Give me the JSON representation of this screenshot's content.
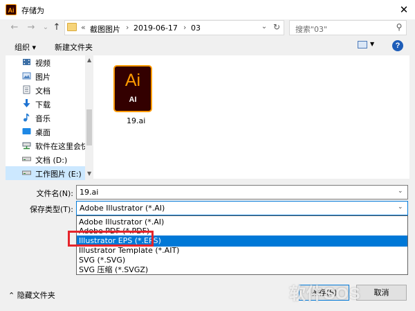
{
  "window": {
    "title": "存储为",
    "app_icon_text": "Ai",
    "close_glyph": "✕"
  },
  "nav": {
    "back": "←",
    "forward": "→",
    "recent": "⌄",
    "up": "↑"
  },
  "address": {
    "overflow": "«",
    "crumbs": [
      "截图图片",
      "2019-06-17",
      "03"
    ],
    "separator": "›",
    "dropdown": "⌄",
    "refresh": "↻"
  },
  "search": {
    "placeholder": "搜索\"03\"",
    "icon": "⚲"
  },
  "toolbar": {
    "organize": "组织 ▾",
    "new_folder": "新建文件夹",
    "help": "?"
  },
  "sidebar": {
    "items": [
      {
        "label": "视频",
        "icon": "video-icon",
        "color": "#3b6ea5"
      },
      {
        "label": "图片",
        "icon": "pictures-icon",
        "color": "#4f83c0"
      },
      {
        "label": "文档",
        "icon": "documents-icon",
        "color": "#6c7a89"
      },
      {
        "label": "下载",
        "icon": "download-icon",
        "color": "#1e73d2"
      },
      {
        "label": "音乐",
        "icon": "music-icon",
        "color": "#2a7fd4"
      },
      {
        "label": "桌面",
        "icon": "desktop-icon",
        "color": "#1e88e5"
      },
      {
        "label": "软件在这里会快",
        "icon": "network-drive-icon",
        "color": "#5a6a7a"
      },
      {
        "label": "文档 (D:)",
        "icon": "drive-icon",
        "color": "#7d7d7d"
      },
      {
        "label": "工作图片 (E:)",
        "icon": "drive-icon",
        "color": "#7d7d7d"
      }
    ],
    "up_arrow": "▲",
    "down_arrow": "▼"
  },
  "content": {
    "file": {
      "icon_text": "Ai",
      "icon_subtext": "AI",
      "name": "19.ai"
    }
  },
  "form": {
    "filename_label": "文件名(N):",
    "filename_value": "19.ai",
    "type_label": "保存类型(T):",
    "type_value": "Adobe Illustrator (*.AI)",
    "dropdown_glyph": "⌄"
  },
  "type_options": [
    {
      "label": "Adobe Illustrator (*.AI)",
      "highlighted": false
    },
    {
      "label": "Adobe PDF (*.PDF)",
      "highlighted": false
    },
    {
      "label": "Illustrator EPS (*.EPS)",
      "highlighted": true
    },
    {
      "label": "Illustrator Template (*.AIT)",
      "highlighted": false
    },
    {
      "label": "SVG (*.SVG)",
      "highlighted": false
    },
    {
      "label": "SVG 压缩 (*.SVGZ)",
      "highlighted": false
    }
  ],
  "footer": {
    "hide_folders": "隐藏文件夹",
    "hide_glyph": "⌃",
    "save": "保存(S)",
    "cancel": "取消"
  },
  "watermark": "软件SOS",
  "colors": {
    "accent": "#0078d7",
    "ai_orange": "#ff9a00",
    "ai_bg": "#330000",
    "annotation_red": "#e6242b"
  }
}
